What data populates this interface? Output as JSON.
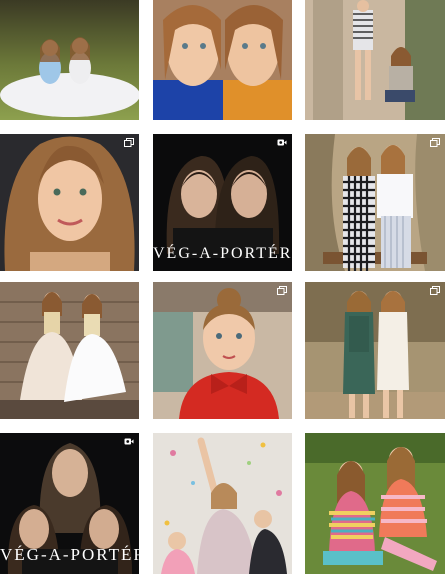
{
  "grid": {
    "posts": [
      {
        "kind": "photo",
        "subject": "twins-in-white-tulle-dresses-on-grass"
      },
      {
        "kind": "photo",
        "subject": "twins-closeup-in-knit-sweaters"
      },
      {
        "kind": "photo",
        "subject": "twins-sitting-on-tree-trunk"
      },
      {
        "kind": "carousel",
        "subject": "girl-portrait-smiling"
      },
      {
        "kind": "video",
        "subject": "twins-dark-portrait",
        "watermark": "VÉG-A-PORTÉR"
      },
      {
        "kind": "carousel",
        "subject": "twins-by-tree-in-plaid-and-white"
      },
      {
        "kind": "photo",
        "subject": "twins-in-tulle-dresses-by-wall"
      },
      {
        "kind": "carousel",
        "subject": "girl-in-red-dress"
      },
      {
        "kind": "carousel",
        "subject": "twins-in-lace-dresses"
      },
      {
        "kind": "video",
        "subject": "mother-with-twins-dark",
        "watermark": "VÉG-A-PORTÉR"
      },
      {
        "kind": "photo",
        "subject": "girl-at-party-with-confetti"
      },
      {
        "kind": "photo",
        "subject": "twins-in-colorful-sweaters-on-grass"
      }
    ]
  },
  "icons": {
    "carousel": "carousel-icon",
    "video": "video-camera-icon"
  },
  "colors": {
    "background": "#ffffff",
    "watermark": "#ffffff"
  }
}
